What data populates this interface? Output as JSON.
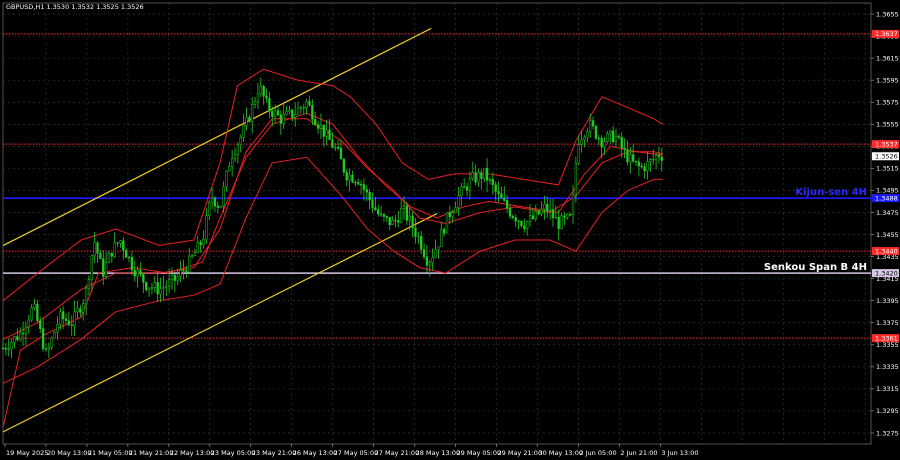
{
  "header": {
    "symbol_line": "GBPUSD,H1  1.3530 1.3532 1.3525 1.3526"
  },
  "chart_data": {
    "type": "candlestick",
    "ylim": [
      1.3265,
      1.3665
    ],
    "y_ticks": [
      "1.3655",
      "1.3635",
      "1.3615",
      "1.3595",
      "1.3575",
      "1.3555",
      "1.3535",
      "1.3515",
      "1.3495",
      "1.3475",
      "1.3455",
      "1.3435",
      "1.3415",
      "1.3395",
      "1.3375",
      "1.3355",
      "1.3335",
      "1.3315",
      "1.3295",
      "1.3275"
    ],
    "x_ticks": [
      "19 May 2025",
      "20 May 13:00",
      "21 May 05:00",
      "21 May 21:00",
      "22 May 13:00",
      "23 May 05:00",
      "23 May 21:00",
      "26 May 13:00",
      "27 May 05:00",
      "27 May 21:00",
      "28 May 13:00",
      "29 May 05:00",
      "29 May 21:00",
      "30 May 13:00",
      "2 Jun 05:00",
      "2 Jun 21:00",
      "3 Jun 13:00"
    ],
    "grid": true,
    "current_price": {
      "value": 1.3526,
      "label": "1.3526"
    },
    "levels": [
      {
        "name": "resistance-1.3637",
        "value": 1.3637,
        "label": "1.3637",
        "color": "#ff2a2a",
        "style": "dotted"
      },
      {
        "name": "resistance-1.3537",
        "value": 1.3537,
        "label": "1.3537",
        "color": "#ff2a2a",
        "style": "dotted"
      },
      {
        "name": "kijun-sen",
        "value": 1.3488,
        "label": "1.3488",
        "text": "Kijun-sen 4H",
        "color": "#1a1aff",
        "style": "solid"
      },
      {
        "name": "support-1.3440",
        "value": 1.344,
        "label": "1.3440",
        "color": "#ff2a2a",
        "style": "dotted"
      },
      {
        "name": "senkou-span-b",
        "value": 1.342,
        "label": "1.3420",
        "text": "Senkou Span B 4H",
        "color": "#d8c8e8",
        "style": "solid"
      },
      {
        "name": "support-1.3361",
        "value": 1.3361,
        "label": "1.3361",
        "color": "#ff2a2a",
        "style": "dotted"
      }
    ],
    "channel": {
      "color": "#f0d020",
      "upper": [
        [
          0.0,
          1.3445
        ],
        [
          0.4933,
          1.3642
        ]
      ],
      "lower": [
        [
          0.0,
          1.3276
        ],
        [
          0.5,
          1.3474
        ]
      ]
    },
    "close_path": [
      [
        0.0,
        1.3352
      ],
      [
        0.02,
        1.3365
      ],
      [
        0.035,
        1.339
      ],
      [
        0.05,
        1.3345
      ],
      [
        0.065,
        1.338
      ],
      [
        0.08,
        1.3375
      ],
      [
        0.095,
        1.34
      ],
      [
        0.105,
        1.345
      ],
      [
        0.115,
        1.342
      ],
      [
        0.125,
        1.344
      ],
      [
        0.135,
        1.345
      ],
      [
        0.15,
        1.3425
      ],
      [
        0.165,
        1.341
      ],
      [
        0.18,
        1.3405
      ],
      [
        0.2,
        1.3415
      ],
      [
        0.215,
        1.343
      ],
      [
        0.23,
        1.345
      ],
      [
        0.24,
        1.349
      ],
      [
        0.25,
        1.348
      ],
      [
        0.262,
        1.3525
      ],
      [
        0.275,
        1.3545
      ],
      [
        0.285,
        1.3565
      ],
      [
        0.295,
        1.359
      ],
      [
        0.305,
        1.357
      ],
      [
        0.32,
        1.356
      ],
      [
        0.335,
        1.3565
      ],
      [
        0.35,
        1.3575
      ],
      [
        0.36,
        1.356
      ],
      [
        0.372,
        1.3545
      ],
      [
        0.385,
        1.353
      ],
      [
        0.395,
        1.351
      ],
      [
        0.41,
        1.3505
      ],
      [
        0.42,
        1.349
      ],
      [
        0.435,
        1.347
      ],
      [
        0.45,
        1.3465
      ],
      [
        0.46,
        1.3478
      ],
      [
        0.47,
        1.3465
      ],
      [
        0.48,
        1.345
      ],
      [
        0.49,
        1.343
      ],
      [
        0.5,
        1.3445
      ],
      [
        0.512,
        1.347
      ],
      [
        0.525,
        1.349
      ],
      [
        0.54,
        1.3505
      ],
      [
        0.555,
        1.351
      ],
      [
        0.57,
        1.349
      ],
      [
        0.585,
        1.3475
      ],
      [
        0.6,
        1.3465
      ],
      [
        0.612,
        1.347
      ],
      [
        0.625,
        1.348
      ],
      [
        0.64,
        1.3465
      ],
      [
        0.655,
        1.347
      ],
      [
        0.662,
        1.354
      ],
      [
        0.675,
        1.3555
      ],
      [
        0.69,
        1.354
      ],
      [
        0.705,
        1.3545
      ],
      [
        0.715,
        1.353
      ],
      [
        0.725,
        1.352
      ],
      [
        0.735,
        1.3515
      ],
      [
        0.745,
        1.352
      ],
      [
        0.755,
        1.3528
      ],
      [
        0.762,
        1.3526
      ]
    ],
    "bollinger": {
      "color": "#e82020",
      "upper": [
        [
          0.0,
          1.3395
        ],
        [
          0.04,
          1.342
        ],
        [
          0.09,
          1.345
        ],
        [
          0.13,
          1.346
        ],
        [
          0.18,
          1.3445
        ],
        [
          0.22,
          1.345
        ],
        [
          0.25,
          1.352
        ],
        [
          0.27,
          1.359
        ],
        [
          0.3,
          1.3605
        ],
        [
          0.34,
          1.3595
        ],
        [
          0.38,
          1.359
        ],
        [
          0.4,
          1.358
        ],
        [
          0.43,
          1.3555
        ],
        [
          0.46,
          1.352
        ],
        [
          0.49,
          1.3505
        ],
        [
          0.52,
          1.351
        ],
        [
          0.56,
          1.351
        ],
        [
          0.6,
          1.3505
        ],
        [
          0.64,
          1.35
        ],
        [
          0.66,
          1.354
        ],
        [
          0.69,
          1.358
        ],
        [
          0.72,
          1.357
        ],
        [
          0.75,
          1.356
        ],
        [
          0.76,
          1.3555
        ]
      ],
      "middle": [
        [
          0.0,
          1.336
        ],
        [
          0.04,
          1.3375
        ],
        [
          0.09,
          1.3405
        ],
        [
          0.13,
          1.342
        ],
        [
          0.18,
          1.342
        ],
        [
          0.22,
          1.3425
        ],
        [
          0.25,
          1.346
        ],
        [
          0.28,
          1.353
        ],
        [
          0.31,
          1.356
        ],
        [
          0.35,
          1.356
        ],
        [
          0.39,
          1.354
        ],
        [
          0.42,
          1.3515
        ],
        [
          0.45,
          1.3495
        ],
        [
          0.48,
          1.347
        ],
        [
          0.51,
          1.3465
        ],
        [
          0.55,
          1.3475
        ],
        [
          0.59,
          1.348
        ],
        [
          0.63,
          1.3475
        ],
        [
          0.66,
          1.349
        ],
        [
          0.69,
          1.352
        ],
        [
          0.72,
          1.353
        ],
        [
          0.75,
          1.353
        ],
        [
          0.76,
          1.3528
        ]
      ],
      "lower": [
        [
          0.0,
          1.332
        ],
        [
          0.04,
          1.3335
        ],
        [
          0.09,
          1.336
        ],
        [
          0.13,
          1.3385
        ],
        [
          0.18,
          1.3395
        ],
        [
          0.22,
          1.34
        ],
        [
          0.25,
          1.341
        ],
        [
          0.28,
          1.347
        ],
        [
          0.31,
          1.352
        ],
        [
          0.35,
          1.3525
        ],
        [
          0.39,
          1.349
        ],
        [
          0.42,
          1.346
        ],
        [
          0.45,
          1.344
        ],
        [
          0.48,
          1.3425
        ],
        [
          0.51,
          1.342
        ],
        [
          0.55,
          1.344
        ],
        [
          0.59,
          1.345
        ],
        [
          0.63,
          1.345
        ],
        [
          0.66,
          1.344
        ],
        [
          0.69,
          1.3475
        ],
        [
          0.72,
          1.3495
        ],
        [
          0.75,
          1.3505
        ],
        [
          0.76,
          1.3505
        ]
      ]
    },
    "kijun_h1": {
      "color": "#e82020",
      "points": [
        [
          0.0,
          1.328
        ],
        [
          0.02,
          1.335
        ],
        [
          0.05,
          1.3365
        ],
        [
          0.09,
          1.338
        ],
        [
          0.11,
          1.342
        ],
        [
          0.15,
          1.3425
        ],
        [
          0.19,
          1.342
        ],
        [
          0.23,
          1.343
        ],
        [
          0.25,
          1.347
        ],
        [
          0.28,
          1.3525
        ],
        [
          0.31,
          1.3555
        ],
        [
          0.35,
          1.3565
        ],
        [
          0.38,
          1.3555
        ],
        [
          0.41,
          1.3525
        ],
        [
          0.44,
          1.35
        ],
        [
          0.47,
          1.348
        ],
        [
          0.5,
          1.347
        ],
        [
          0.53,
          1.348
        ],
        [
          0.56,
          1.3485
        ],
        [
          0.6,
          1.348
        ],
        [
          0.64,
          1.3475
        ],
        [
          0.67,
          1.351
        ],
        [
          0.7,
          1.3535
        ],
        [
          0.73,
          1.353
        ],
        [
          0.76,
          1.3527
        ]
      ]
    }
  }
}
